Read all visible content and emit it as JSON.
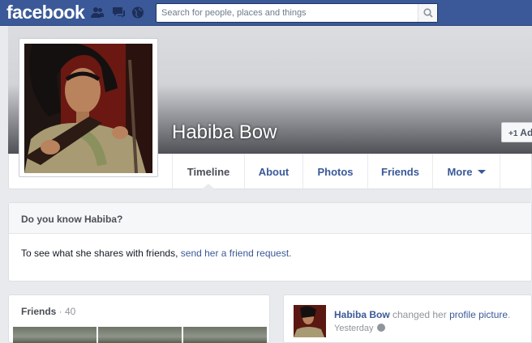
{
  "topbar": {
    "logo": "facebook",
    "search_placeholder": "Search for people, places and things",
    "icons": [
      "friend-requests-icon",
      "messages-icon",
      "notifications-globe-icon",
      "search-icon"
    ]
  },
  "profile": {
    "name": "Habiba Bow",
    "add_friend_label": "Add"
  },
  "tabs": [
    {
      "label": "Timeline",
      "active": true
    },
    {
      "label": "About"
    },
    {
      "label": "Photos"
    },
    {
      "label": "Friends"
    },
    {
      "label": "More"
    }
  ],
  "know_card": {
    "title": "Do you know Habiba?",
    "text": "To see what she shares with friends, ",
    "link": "send her a friend request."
  },
  "friends_card": {
    "title": "Friends",
    "count": " · 40"
  },
  "activity": {
    "who": "Habiba Bow",
    "action": " changed her ",
    "what": "profile picture",
    "period": ".",
    "time": "Yesterday"
  },
  "colors": {
    "brand": "#3b5998",
    "background": "#e9eaed",
    "link": "#3b5998"
  }
}
